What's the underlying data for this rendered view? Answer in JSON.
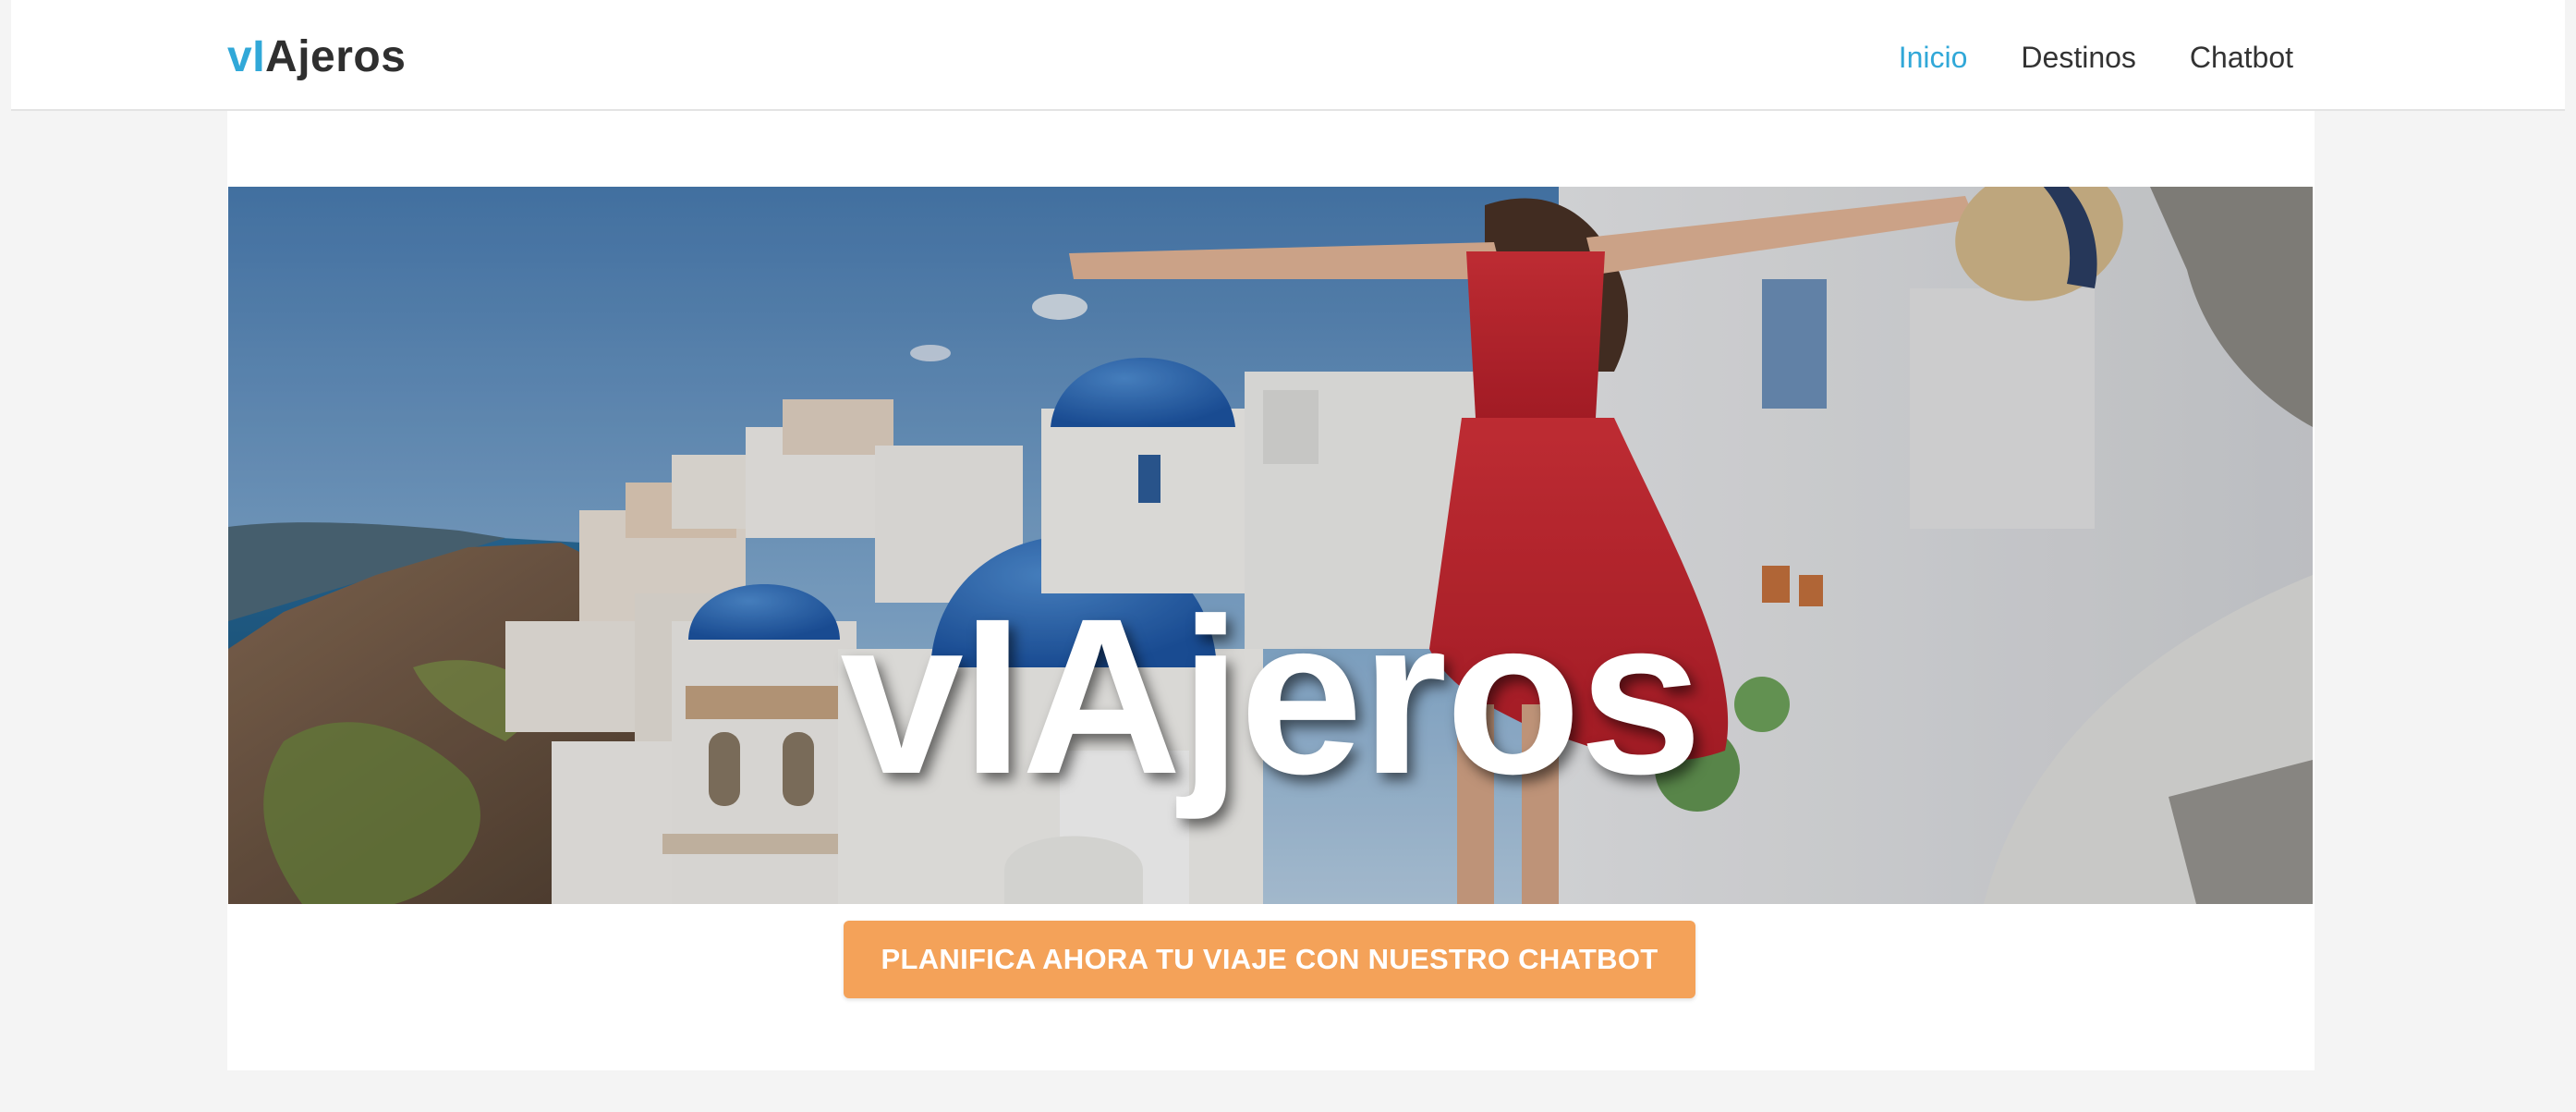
{
  "navbar": {
    "brand_accent": "vI",
    "brand_rest": "Ajeros",
    "links": [
      {
        "label": "Inicio"
      },
      {
        "label": "Destinos"
      },
      {
        "label": "Chatbot"
      }
    ]
  },
  "hero": {
    "title": "vIAjeros",
    "image": "Santorini village with blue domes and a woman in a red dress"
  },
  "cta": {
    "label": "PLANIFICA AHORA TU VIAJE CON NUESTRO CHATBOT"
  },
  "colors": {
    "accent": "#31a8d8",
    "cta": "#f4a259",
    "text": "#333333",
    "background": "#f4f4f4"
  }
}
